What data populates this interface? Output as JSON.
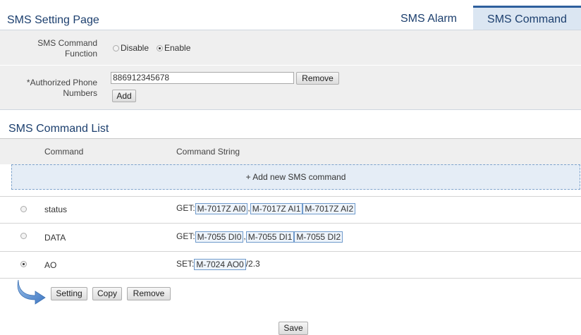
{
  "header": {
    "title": "SMS Setting Page",
    "tabs": [
      {
        "label": "SMS Alarm",
        "active": false
      },
      {
        "label": "SMS Command",
        "active": true
      }
    ]
  },
  "function": {
    "label": "SMS Command Function",
    "options": [
      {
        "label": "Disable",
        "selected": false
      },
      {
        "label": "Enable",
        "selected": true
      }
    ]
  },
  "phones": {
    "label": "*Authorized Phone Numbers",
    "value": "886912345678",
    "remove_label": "Remove",
    "add_label": "Add"
  },
  "list": {
    "title": "SMS Command List",
    "headers": {
      "command": "Command",
      "string": "Command String"
    },
    "add_label": "+ Add new SMS command",
    "rows": [
      {
        "name": "status",
        "selected": false,
        "prefix": "GET:",
        "items": [
          "M-7017Z AI0",
          "M-7017Z AI1",
          "M-7017Z AI2"
        ],
        "suffix": ""
      },
      {
        "name": "DATA",
        "selected": false,
        "prefix": "GET:",
        "items": [
          "M-7055 DI0",
          "M-7055 DI1",
          "M-7055 DI2"
        ],
        "suffix": ""
      },
      {
        "name": "AO",
        "selected": true,
        "prefix": "SET:",
        "items": [
          "M-7024 AO0"
        ],
        "suffix": "/2.3"
      }
    ],
    "separator": ","
  },
  "actions": {
    "setting_label": "Setting",
    "copy_label": "Copy",
    "remove_label": "Remove"
  },
  "save_label": "Save",
  "colors": {
    "accent": "#1c3f6e",
    "tab_active_bg": "#dbe6f2",
    "tab_active_border": "#2e5f9d",
    "row_bg": "#efefef",
    "add_row_bg": "#e5edf6",
    "tag_border": "#6f9acb"
  }
}
